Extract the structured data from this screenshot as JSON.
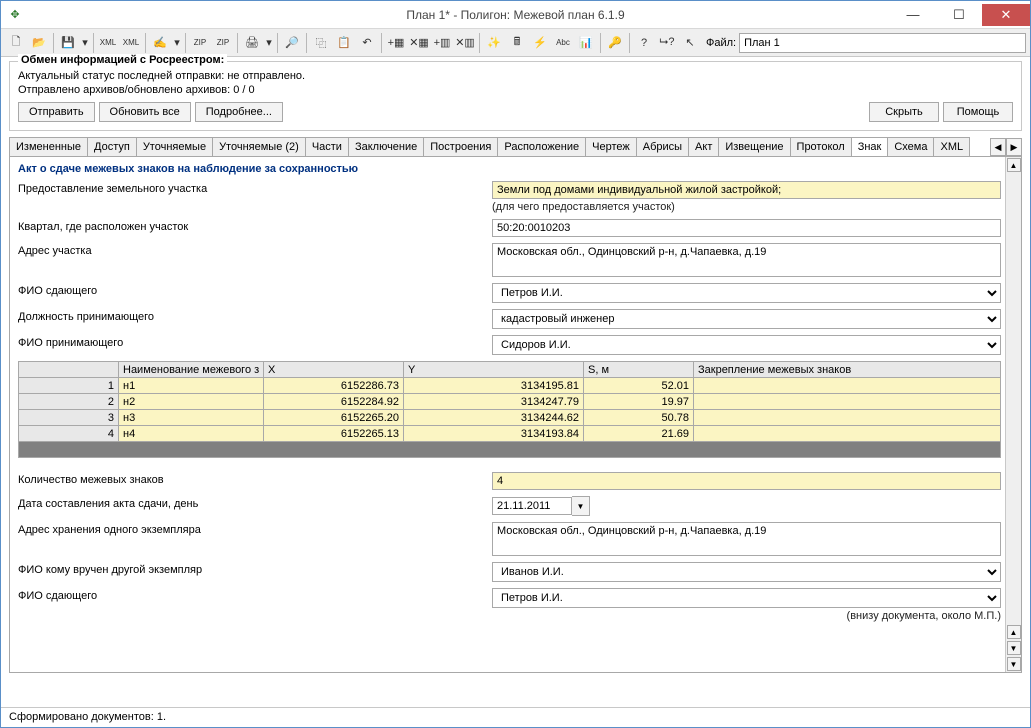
{
  "window": {
    "title": "План 1* - Полигон: Межевой план 6.1.9"
  },
  "toolbar": {
    "file_label": "Файл:",
    "file_value": "План 1"
  },
  "rosreestr": {
    "legend": "Обмен информацией с Росреестром:",
    "line1": "Актуальный статус последней отправки: не отправлено.",
    "line2": "Отправлено архивов/обновлено архивов: 0 / 0",
    "btn_send": "Отправить",
    "btn_refresh": "Обновить все",
    "btn_more": "Подробнее...",
    "btn_hide": "Скрыть",
    "btn_help": "Помощь"
  },
  "tabs": [
    "Измененные",
    "Доступ",
    "Уточняемые",
    "Уточняемые (2)",
    "Части",
    "Заключение",
    "Построения",
    "Расположение",
    "Чертеж",
    "Абрисы",
    "Акт",
    "Извещение",
    "Протокол",
    "Знак",
    "Схема",
    "XML"
  ],
  "active_tab": "Знак",
  "form": {
    "section_title": "Акт о сдаче межевых знаков на наблюдение за сохранностью",
    "f1_label": "Предоставление земельного участка",
    "f1_value": "Земли под домами индивидуальной жилой застройкой;",
    "f1_hint": "(для чего предоставляется участок)",
    "f2_label": "Квартал, где расположен участок",
    "f2_value": "50:20:0010203",
    "f3_label": "Адрес участка",
    "f3_value": "Московская обл., Одинцовский р-н, д.Чапаевка, д.19",
    "f4_label": "ФИО сдающего",
    "f4_value": "Петров И.И.",
    "f5_label": "Должность принимающего",
    "f5_value": "кадастровый инженер",
    "f6_label": "ФИО принимающего",
    "f6_value": "Сидоров И.И.",
    "grid_headers": [
      "",
      "Наименование межевого з",
      "X",
      "Y",
      "S, м",
      "Закрепление межевых  знаков"
    ],
    "grid_rows": [
      {
        "n": "1",
        "name": "н1",
        "x": "6152286.73",
        "y": "3134195.81",
        "s": "52.01",
        "z": ""
      },
      {
        "n": "2",
        "name": "н2",
        "x": "6152284.92",
        "y": "3134247.79",
        "s": "19.97",
        "z": ""
      },
      {
        "n": "3",
        "name": "н3",
        "x": "6152265.20",
        "y": "3134244.62",
        "s": "50.78",
        "z": ""
      },
      {
        "n": "4",
        "name": "н4",
        "x": "6152265.13",
        "y": "3134193.84",
        "s": "21.69",
        "z": ""
      }
    ],
    "f7_label": "Количество межевых знаков",
    "f7_value": "4",
    "f8_label": "Дата составления акта сдачи, день",
    "f8_value": "21.11.2011",
    "f9_label": "Адрес хранения одного экземпляра",
    "f9_value": "Московская обл., Одинцовский р-н, д.Чапаевка, д.19",
    "f10_label": "ФИО кому вручен другой экземпляр",
    "f10_value": "Иванов И.И.",
    "f11_label": "ФИО сдающего",
    "f11_value": "Петров И.И.",
    "f11_hint": "(внизу документа, около М.П.)"
  },
  "statusbar": "Сформировано документов: 1."
}
